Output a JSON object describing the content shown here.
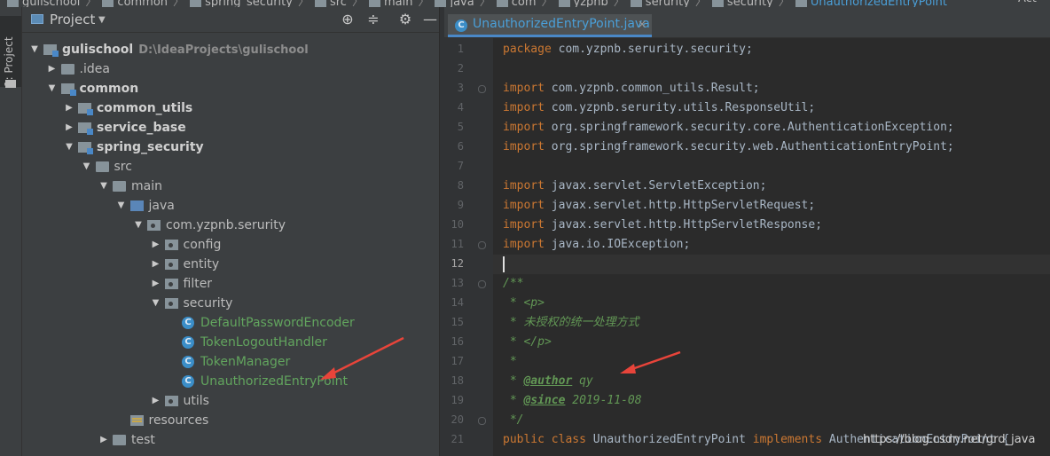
{
  "breadcrumb": [
    "gulischool",
    "common",
    "spring_security",
    "src",
    "main",
    "java",
    "com",
    "yzpnb",
    "serurity",
    "security",
    "UnauthorizedEntryPoint"
  ],
  "right_toolbar_fragment": "Act",
  "sidebar": {
    "project_tab_label": "1: Project"
  },
  "project_panel": {
    "title": "Project",
    "tree": [
      {
        "label": "gulischool",
        "path": "D:\\IdeaProjects\\gulischool",
        "depth": 0,
        "expanded": true,
        "icon": "module",
        "bold": true
      },
      {
        "label": ".idea",
        "depth": 1,
        "expanded": false,
        "icon": "folder"
      },
      {
        "label": "common",
        "depth": 1,
        "expanded": true,
        "icon": "module",
        "bold": true
      },
      {
        "label": "common_utils",
        "depth": 2,
        "expanded": false,
        "icon": "module",
        "bold": true
      },
      {
        "label": "service_base",
        "depth": 2,
        "expanded": false,
        "icon": "module",
        "bold": true
      },
      {
        "label": "spring_security",
        "depth": 2,
        "expanded": true,
        "icon": "module",
        "bold": true
      },
      {
        "label": "src",
        "depth": 3,
        "expanded": true,
        "icon": "folder"
      },
      {
        "label": "main",
        "depth": 4,
        "expanded": true,
        "icon": "folder"
      },
      {
        "label": "java",
        "depth": 5,
        "expanded": true,
        "icon": "source-folder"
      },
      {
        "label": "com.yzpnb.serurity",
        "depth": 6,
        "expanded": true,
        "icon": "package"
      },
      {
        "label": "config",
        "depth": 7,
        "expanded": false,
        "icon": "package"
      },
      {
        "label": "entity",
        "depth": 7,
        "expanded": false,
        "icon": "package"
      },
      {
        "label": "filter",
        "depth": 7,
        "expanded": false,
        "icon": "package"
      },
      {
        "label": "security",
        "depth": 7,
        "expanded": true,
        "icon": "package"
      },
      {
        "label": "DefaultPasswordEncoder",
        "depth": 8,
        "icon": "class",
        "green": true
      },
      {
        "label": "TokenLogoutHandler",
        "depth": 8,
        "icon": "class",
        "green": true
      },
      {
        "label": "TokenManager",
        "depth": 8,
        "icon": "class",
        "green": true
      },
      {
        "label": "UnauthorizedEntryPoint",
        "depth": 8,
        "icon": "class",
        "green": true
      },
      {
        "label": "utils",
        "depth": 7,
        "expanded": false,
        "icon": "package"
      },
      {
        "label": "resources",
        "depth": 5,
        "icon": "resources"
      },
      {
        "label": "test",
        "depth": 4,
        "expanded": false,
        "icon": "folder"
      }
    ]
  },
  "editor": {
    "tab": "UnauthorizedEntryPoint.java",
    "caret_line": 12,
    "lines": [
      {
        "n": 1,
        "t": [
          [
            "kw",
            "package"
          ],
          [
            "p",
            " com.yzpnb.serurity.security;"
          ]
        ]
      },
      {
        "n": 2,
        "t": []
      },
      {
        "n": 3,
        "t": [
          [
            "kw",
            "import"
          ],
          [
            "p",
            " com.yzpnb.common_utils.Result;"
          ]
        ],
        "fold": true
      },
      {
        "n": 4,
        "t": [
          [
            "kw",
            "import"
          ],
          [
            "p",
            " com.yzpnb.serurity.utils.ResponseUtil;"
          ]
        ]
      },
      {
        "n": 5,
        "t": [
          [
            "kw",
            "import"
          ],
          [
            "p",
            " org.springframework.security.core.AuthenticationException;"
          ]
        ]
      },
      {
        "n": 6,
        "t": [
          [
            "kw",
            "import"
          ],
          [
            "p",
            " org.springframework.security.web.AuthenticationEntryPoint;"
          ]
        ]
      },
      {
        "n": 7,
        "t": []
      },
      {
        "n": 8,
        "t": [
          [
            "kw",
            "import"
          ],
          [
            "p",
            " javax.servlet.ServletException;"
          ]
        ]
      },
      {
        "n": 9,
        "t": [
          [
            "kw",
            "import"
          ],
          [
            "p",
            " javax.servlet.http.HttpServletRequest;"
          ]
        ]
      },
      {
        "n": 10,
        "t": [
          [
            "kw",
            "import"
          ],
          [
            "p",
            " javax.servlet.http.HttpServletResponse;"
          ]
        ]
      },
      {
        "n": 11,
        "t": [
          [
            "kw",
            "import"
          ],
          [
            "p",
            " java.io.IOException;"
          ]
        ],
        "fold": true
      },
      {
        "n": 12,
        "t": []
      },
      {
        "n": 13,
        "t": [
          [
            "doc",
            "/**"
          ]
        ],
        "fold": true
      },
      {
        "n": 14,
        "t": [
          [
            "doc",
            " * <p>"
          ]
        ]
      },
      {
        "n": 15,
        "t": [
          [
            "doc",
            " * 未授权的统一处理方式"
          ]
        ]
      },
      {
        "n": 16,
        "t": [
          [
            "doc",
            " * </p>"
          ]
        ]
      },
      {
        "n": 17,
        "t": [
          [
            "doc",
            " *"
          ]
        ]
      },
      {
        "n": 18,
        "t": [
          [
            "doc",
            " * "
          ],
          [
            "tag",
            "@author"
          ],
          [
            "doc",
            " qy"
          ]
        ]
      },
      {
        "n": 19,
        "t": [
          [
            "doc",
            " * "
          ],
          [
            "tag",
            "@since"
          ],
          [
            "doc",
            " 2019-11-08"
          ]
        ]
      },
      {
        "n": 20,
        "t": [
          [
            "doc",
            " */"
          ]
        ],
        "fold": true
      },
      {
        "n": 21,
        "t": [
          [
            "kw",
            "public class"
          ],
          [
            "p",
            " UnauthorizedEntryPoint "
          ],
          [
            "kw",
            "implements"
          ],
          [
            "p",
            " AuthenticationEntryPoint {"
          ]
        ]
      }
    ]
  },
  "watermark": "https://blog.csdn.net/grd_java",
  "colors": {
    "annotation_arrow": "#e8443a",
    "link_blue": "#4a9fd8",
    "class_green": "#62a55e"
  }
}
